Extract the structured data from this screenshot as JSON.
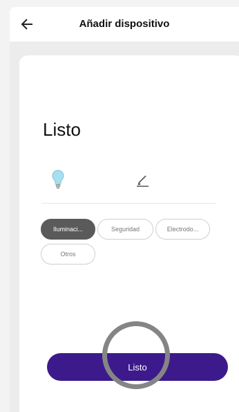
{
  "header": {
    "title": "Añadir dispositivo",
    "back_icon": "arrow-left-icon"
  },
  "card": {
    "title": "Listo",
    "device_icon": "lightbulb-icon",
    "edit_icon": "pencil-icon"
  },
  "categories": [
    {
      "label": "Iluminaci...",
      "selected": true
    },
    {
      "label": "Seguridad",
      "selected": false
    },
    {
      "label": "Electrodo...",
      "selected": false
    },
    {
      "label": "Otros",
      "selected": false
    }
  ],
  "primary_button": {
    "label": "Listo"
  },
  "colors": {
    "accent": "#3c1a8c",
    "chip_selected": "#5a5a5a",
    "bulb": "#a8dff0"
  }
}
